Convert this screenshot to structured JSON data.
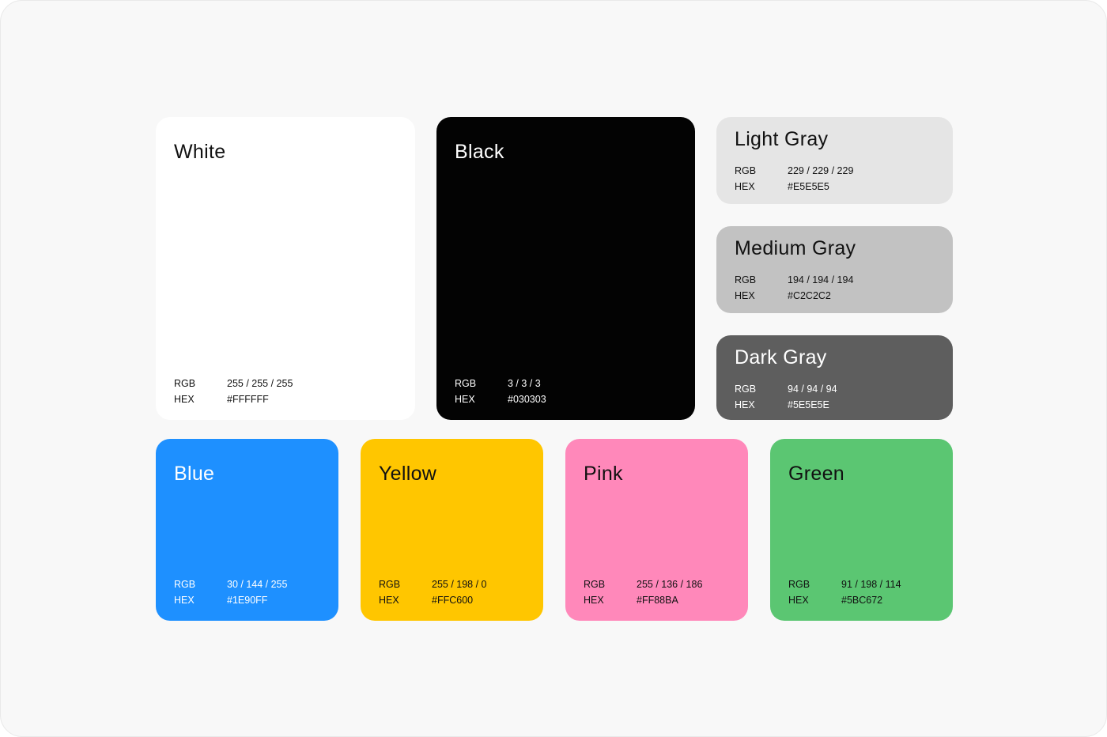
{
  "swatches": {
    "white": {
      "name": "White",
      "rgb_label": "RGB",
      "hex_label": "HEX",
      "rgb": "255 / 255 / 255",
      "hex": "#FFFFFF",
      "color": "#FFFFFF"
    },
    "black": {
      "name": "Black",
      "rgb_label": "RGB",
      "hex_label": "HEX",
      "rgb": "3 / 3 / 3",
      "hex": "#030303",
      "color": "#030303"
    },
    "light_gray": {
      "name": "Light Gray",
      "rgb_label": "RGB",
      "hex_label": "HEX",
      "rgb": "229 / 229 / 229",
      "hex": "#E5E5E5",
      "color": "#E5E5E5"
    },
    "medium_gray": {
      "name": "Medium Gray",
      "rgb_label": "RGB",
      "hex_label": "HEX",
      "rgb": "194 / 194 / 194",
      "hex": "#C2C2C2",
      "color": "#C2C2C2"
    },
    "dark_gray": {
      "name": "Dark Gray",
      "rgb_label": "RGB",
      "hex_label": "HEX",
      "rgb": "94 / 94 / 94",
      "hex": "#5E5E5E",
      "color": "#5E5E5E"
    },
    "blue": {
      "name": "Blue",
      "rgb_label": "RGB",
      "hex_label": "HEX",
      "rgb": "30 / 144 / 255",
      "hex": "#1E90FF",
      "color": "#1E90FF"
    },
    "yellow": {
      "name": "Yellow",
      "rgb_label": "RGB",
      "hex_label": "HEX",
      "rgb": "255 / 198 / 0",
      "hex": "#FFC600",
      "color": "#FFC600"
    },
    "pink": {
      "name": "Pink",
      "rgb_label": "RGB",
      "hex_label": "HEX",
      "rgb": "255 / 136 / 186",
      "hex": "#FF88BA",
      "color": "#FF88BA"
    },
    "green": {
      "name": "Green",
      "rgb_label": "RGB",
      "hex_label": "HEX",
      "rgb": "91 / 198 / 114",
      "hex": "#5BC672",
      "color": "#5BC672"
    }
  }
}
